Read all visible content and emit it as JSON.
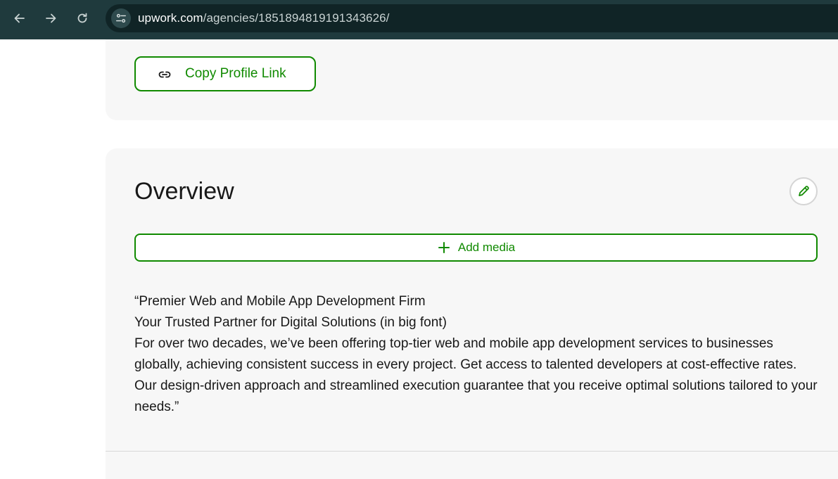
{
  "browser": {
    "url_host": "upwork.com",
    "url_path": "/agencies/1851894819191343626/",
    "icons": [
      "back-arrow-icon",
      "forward-arrow-icon",
      "reload-icon",
      "site-info-icon"
    ]
  },
  "profile_actions": {
    "copy_link_label": "Copy Profile Link",
    "copy_link_icon": "link-icon"
  },
  "overview": {
    "title": "Overview",
    "edit_icon": "pencil-icon",
    "add_media_label": "Add media",
    "add_media_icon": "plus-icon",
    "paragraphs": [
      "“Premier Web and Mobile App Development Firm",
      "Your Trusted Partner for Digital Solutions (in big font)",
      "For over two decades, we’ve been offering top-tier web and mobile app development services to businesses globally, achieving consistent success in every project. Get access to talented developers at cost-effective rates. Our design-driven approach and streamlined execution guarantee that you receive optimal solutions tailored to your needs.”"
    ]
  },
  "colors": {
    "brand_green": "#108a00",
    "browser_bar": "#1f3a3d",
    "card_bg": "#f7f7f7"
  }
}
